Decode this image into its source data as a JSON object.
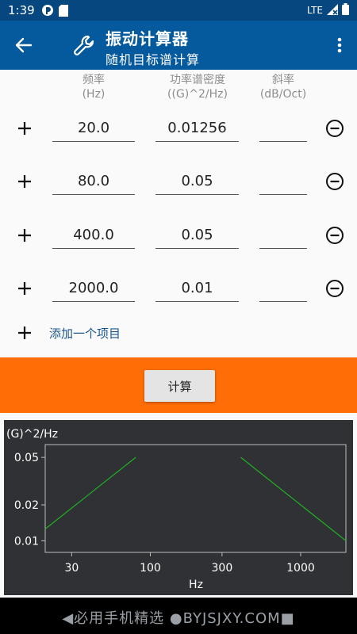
{
  "status_bar": {
    "time": "1:39",
    "network": "LTE"
  },
  "app_bar": {
    "title": "振动计算器",
    "subtitle": "随机目标谱计算"
  },
  "columns": {
    "freq": {
      "label": "频率",
      "unit": "(Hz)"
    },
    "psd": {
      "label": "功率谱密度",
      "unit": "((G)^2/Hz)"
    },
    "slope": {
      "label": "斜率",
      "unit": "(dB/Oct)"
    }
  },
  "rows": [
    {
      "freq": "20.0",
      "psd": "0.01256",
      "slope": ""
    },
    {
      "freq": "80.0",
      "psd": "0.05",
      "slope": ""
    },
    {
      "freq": "400.0",
      "psd": "0.05",
      "slope": ""
    },
    {
      "freq": "2000.0",
      "psd": "0.01",
      "slope": ""
    }
  ],
  "add_item_label": "添加一个项目",
  "calculate_label": "计算",
  "colors": {
    "primary": "#05599d",
    "status": "#05477e",
    "accent": "#ff6e06",
    "chart_bg": "#2f3135",
    "series": "#21b021"
  },
  "chart_data": {
    "type": "line",
    "title": "",
    "ylabel": "(G)^2/Hz",
    "xlabel": "Hz",
    "x_scale": "log",
    "y_scale": "log",
    "xlim": [
      20,
      2000
    ],
    "ylim": [
      0.008,
      0.064
    ],
    "x_ticks": [
      30,
      100,
      300,
      1000
    ],
    "x_tick_labels": [
      "30",
      "100",
      "300",
      "1000"
    ],
    "y_ticks": [
      0.01,
      0.02,
      0.05
    ],
    "y_tick_labels": [
      "0.01",
      "0.02",
      "0.05"
    ],
    "series": [
      {
        "points": [
          [
            20,
            0.01256
          ],
          [
            80,
            0.05
          ]
        ]
      },
      {
        "points": [
          [
            400,
            0.05
          ],
          [
            2000,
            0.01
          ]
        ]
      }
    ]
  },
  "watermark": "◀必用手机精选 ●BYJSJXY.COM■"
}
